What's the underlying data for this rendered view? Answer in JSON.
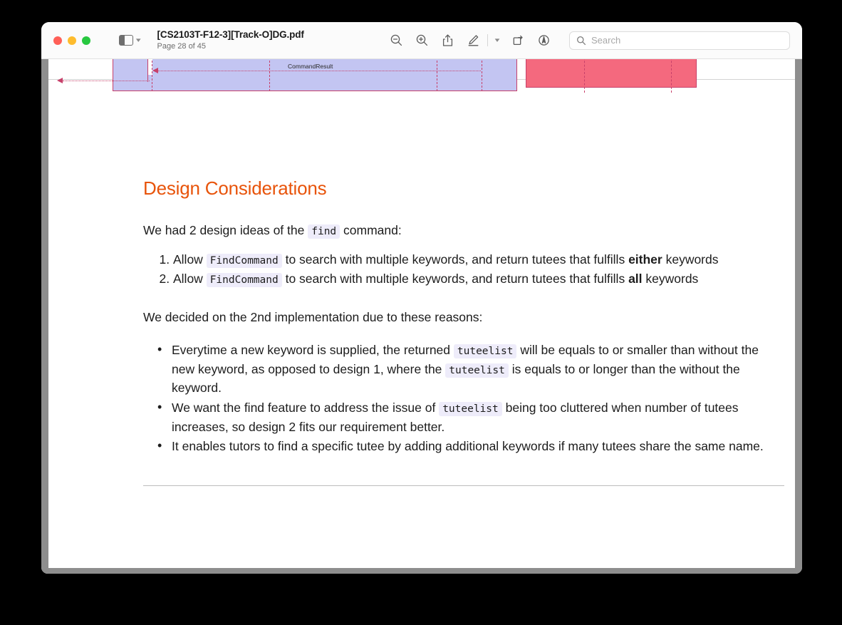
{
  "window": {
    "traffic_lights": [
      "close",
      "minimize",
      "maximize"
    ]
  },
  "titlebar": {
    "sidebar_toggle_label": "sidebar-toggle",
    "document_name": "[CS2103T-F12-3][Track-O]DG.pdf",
    "page_indicator": "Page 28 of 45",
    "tools": [
      {
        "name": "zoom-out-icon",
        "label": "Zoom Out"
      },
      {
        "name": "zoom-in-icon",
        "label": "Zoom In"
      },
      {
        "name": "share-icon",
        "label": "Share"
      },
      {
        "name": "markup-icon",
        "label": "Markup"
      },
      {
        "name": "chevron-down-icon",
        "label": "Markup Options"
      },
      {
        "name": "rotate-icon",
        "label": "Rotate"
      },
      {
        "name": "annotate-icon",
        "label": "Annotate"
      }
    ],
    "search": {
      "placeholder": "Search",
      "value": ""
    }
  },
  "diagram": {
    "label": "CommandResult",
    "colors": {
      "activation_fill": "#c3c5f2",
      "activation_border": "#c7406a",
      "red_fill": "#f4697e",
      "lifeline": "#c7406a"
    }
  },
  "document": {
    "heading": "Design Considerations",
    "heading_color": "#e8540b",
    "intro": {
      "before_code": "We had 2 design ideas of the ",
      "code": "find",
      "after_code": " command:"
    },
    "numbered_items": [
      {
        "before_code": "Allow ",
        "code": "FindCommand",
        "middle": " to search with multiple keywords, and return tutees that fulfills ",
        "bold": "either",
        "after_bold": " keywords"
      },
      {
        "before_code": "Allow ",
        "code": "FindCommand",
        "middle": " to search with multiple keywords, and return tutees that fulfills ",
        "bold": "all",
        "after_bold": " keywords"
      }
    ],
    "reasons_intro": "We decided on the 2nd implementation due to these reasons:",
    "bullets": [
      {
        "p1": "Everytime a new keyword is supplied, the returned ",
        "c1": "tuteelist",
        "p2": " will be equals to or smaller than without the new keyword, as opposed to design 1, where the ",
        "c2": "tuteelist",
        "p3": " is equals to or longer than the without the keyword."
      },
      {
        "p1": "We want the find feature to address the issue of ",
        "c1": "tuteelist",
        "p2": " being too cluttered when number of tutees increases, so design 2 fits our requirement better.",
        "c2": "",
        "p3": ""
      },
      {
        "p1": "It enables tutors to find a specific tutee by adding additional keywords if many tutees share the same name.",
        "c1": "",
        "p2": "",
        "c2": "",
        "p3": ""
      }
    ]
  }
}
